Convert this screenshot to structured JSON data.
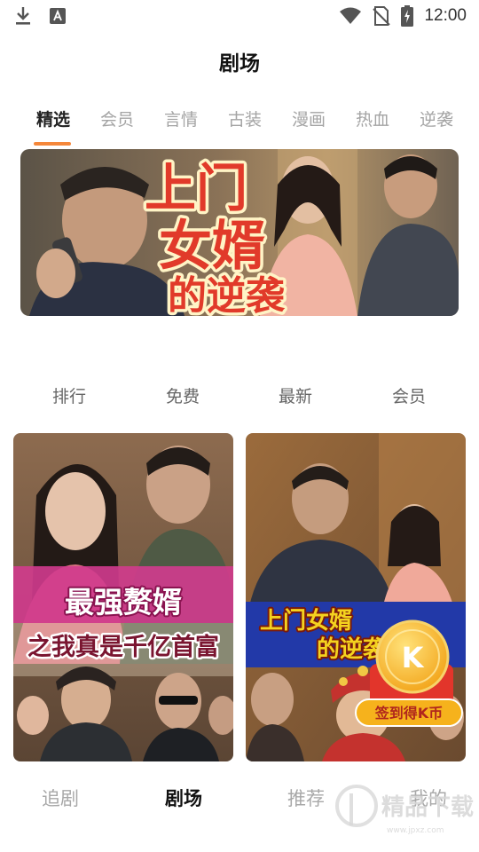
{
  "status_bar": {
    "time": "12:00",
    "icons": [
      "download-icon",
      "accessibility-icon",
      "wifi-icon",
      "no-sim-icon",
      "battery-charging-icon"
    ]
  },
  "header": {
    "title": "剧场"
  },
  "tabs": [
    {
      "label": "精选",
      "active": true
    },
    {
      "label": "会员",
      "active": false
    },
    {
      "label": "言情",
      "active": false
    },
    {
      "label": "古装",
      "active": false
    },
    {
      "label": "漫画",
      "active": false
    },
    {
      "label": "热血",
      "active": false
    },
    {
      "label": "逆袭",
      "active": false
    }
  ],
  "banner": {
    "title_line1": "上门",
    "title_line2": "女婿",
    "title_line3": "的逆袭"
  },
  "categories": [
    {
      "label": "排行"
    },
    {
      "label": "免费"
    },
    {
      "label": "最新"
    },
    {
      "label": "会员"
    }
  ],
  "cards": [
    {
      "title_line1": "最强赘婿",
      "title_line2": "之我真是千亿首富"
    },
    {
      "title_line1": "上门女婿",
      "title_line2": "的逆袭",
      "reward_coin": "K",
      "reward_label": "签到得K币"
    }
  ],
  "bottom_nav": [
    {
      "label": "追剧",
      "active": false
    },
    {
      "label": "剧场",
      "active": true
    },
    {
      "label": "推荐",
      "active": false
    },
    {
      "label": "我的",
      "active": false
    }
  ],
  "watermark": {
    "text": "精品下载",
    "url_text": "www.jpxz.com"
  },
  "colors": {
    "accent": "#f5873a",
    "inactive_text": "#a4a4a4",
    "reward_gold": "#f6b21c",
    "reward_red": "#e2352b"
  }
}
